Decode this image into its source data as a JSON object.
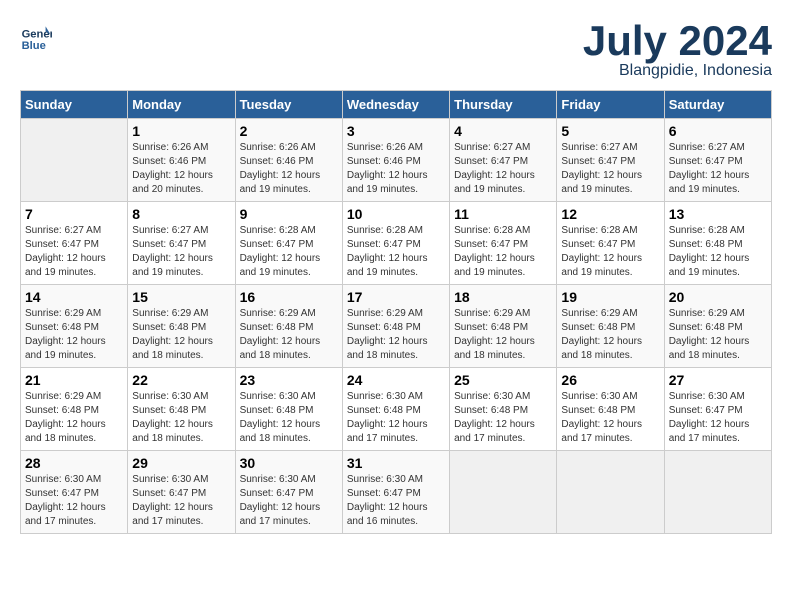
{
  "header": {
    "logo_line1": "General",
    "logo_line2": "Blue",
    "month": "July 2024",
    "location": "Blangpidie, Indonesia"
  },
  "weekdays": [
    "Sunday",
    "Monday",
    "Tuesday",
    "Wednesday",
    "Thursday",
    "Friday",
    "Saturday"
  ],
  "weeks": [
    [
      {
        "day": "",
        "info": ""
      },
      {
        "day": "1",
        "info": "Sunrise: 6:26 AM\nSunset: 6:46 PM\nDaylight: 12 hours\nand 20 minutes."
      },
      {
        "day": "2",
        "info": "Sunrise: 6:26 AM\nSunset: 6:46 PM\nDaylight: 12 hours\nand 19 minutes."
      },
      {
        "day": "3",
        "info": "Sunrise: 6:26 AM\nSunset: 6:46 PM\nDaylight: 12 hours\nand 19 minutes."
      },
      {
        "day": "4",
        "info": "Sunrise: 6:27 AM\nSunset: 6:47 PM\nDaylight: 12 hours\nand 19 minutes."
      },
      {
        "day": "5",
        "info": "Sunrise: 6:27 AM\nSunset: 6:47 PM\nDaylight: 12 hours\nand 19 minutes."
      },
      {
        "day": "6",
        "info": "Sunrise: 6:27 AM\nSunset: 6:47 PM\nDaylight: 12 hours\nand 19 minutes."
      }
    ],
    [
      {
        "day": "7",
        "info": "Sunrise: 6:27 AM\nSunset: 6:47 PM\nDaylight: 12 hours\nand 19 minutes."
      },
      {
        "day": "8",
        "info": "Sunrise: 6:27 AM\nSunset: 6:47 PM\nDaylight: 12 hours\nand 19 minutes."
      },
      {
        "day": "9",
        "info": "Sunrise: 6:28 AM\nSunset: 6:47 PM\nDaylight: 12 hours\nand 19 minutes."
      },
      {
        "day": "10",
        "info": "Sunrise: 6:28 AM\nSunset: 6:47 PM\nDaylight: 12 hours\nand 19 minutes."
      },
      {
        "day": "11",
        "info": "Sunrise: 6:28 AM\nSunset: 6:47 PM\nDaylight: 12 hours\nand 19 minutes."
      },
      {
        "day": "12",
        "info": "Sunrise: 6:28 AM\nSunset: 6:47 PM\nDaylight: 12 hours\nand 19 minutes."
      },
      {
        "day": "13",
        "info": "Sunrise: 6:28 AM\nSunset: 6:48 PM\nDaylight: 12 hours\nand 19 minutes."
      }
    ],
    [
      {
        "day": "14",
        "info": "Sunrise: 6:29 AM\nSunset: 6:48 PM\nDaylight: 12 hours\nand 19 minutes."
      },
      {
        "day": "15",
        "info": "Sunrise: 6:29 AM\nSunset: 6:48 PM\nDaylight: 12 hours\nand 18 minutes."
      },
      {
        "day": "16",
        "info": "Sunrise: 6:29 AM\nSunset: 6:48 PM\nDaylight: 12 hours\nand 18 minutes."
      },
      {
        "day": "17",
        "info": "Sunrise: 6:29 AM\nSunset: 6:48 PM\nDaylight: 12 hours\nand 18 minutes."
      },
      {
        "day": "18",
        "info": "Sunrise: 6:29 AM\nSunset: 6:48 PM\nDaylight: 12 hours\nand 18 minutes."
      },
      {
        "day": "19",
        "info": "Sunrise: 6:29 AM\nSunset: 6:48 PM\nDaylight: 12 hours\nand 18 minutes."
      },
      {
        "day": "20",
        "info": "Sunrise: 6:29 AM\nSunset: 6:48 PM\nDaylight: 12 hours\nand 18 minutes."
      }
    ],
    [
      {
        "day": "21",
        "info": "Sunrise: 6:29 AM\nSunset: 6:48 PM\nDaylight: 12 hours\nand 18 minutes."
      },
      {
        "day": "22",
        "info": "Sunrise: 6:30 AM\nSunset: 6:48 PM\nDaylight: 12 hours\nand 18 minutes."
      },
      {
        "day": "23",
        "info": "Sunrise: 6:30 AM\nSunset: 6:48 PM\nDaylight: 12 hours\nand 18 minutes."
      },
      {
        "day": "24",
        "info": "Sunrise: 6:30 AM\nSunset: 6:48 PM\nDaylight: 12 hours\nand 17 minutes."
      },
      {
        "day": "25",
        "info": "Sunrise: 6:30 AM\nSunset: 6:48 PM\nDaylight: 12 hours\nand 17 minutes."
      },
      {
        "day": "26",
        "info": "Sunrise: 6:30 AM\nSunset: 6:48 PM\nDaylight: 12 hours\nand 17 minutes."
      },
      {
        "day": "27",
        "info": "Sunrise: 6:30 AM\nSunset: 6:47 PM\nDaylight: 12 hours\nand 17 minutes."
      }
    ],
    [
      {
        "day": "28",
        "info": "Sunrise: 6:30 AM\nSunset: 6:47 PM\nDaylight: 12 hours\nand 17 minutes."
      },
      {
        "day": "29",
        "info": "Sunrise: 6:30 AM\nSunset: 6:47 PM\nDaylight: 12 hours\nand 17 minutes."
      },
      {
        "day": "30",
        "info": "Sunrise: 6:30 AM\nSunset: 6:47 PM\nDaylight: 12 hours\nand 17 minutes."
      },
      {
        "day": "31",
        "info": "Sunrise: 6:30 AM\nSunset: 6:47 PM\nDaylight: 12 hours\nand 16 minutes."
      },
      {
        "day": "",
        "info": ""
      },
      {
        "day": "",
        "info": ""
      },
      {
        "day": "",
        "info": ""
      }
    ]
  ]
}
